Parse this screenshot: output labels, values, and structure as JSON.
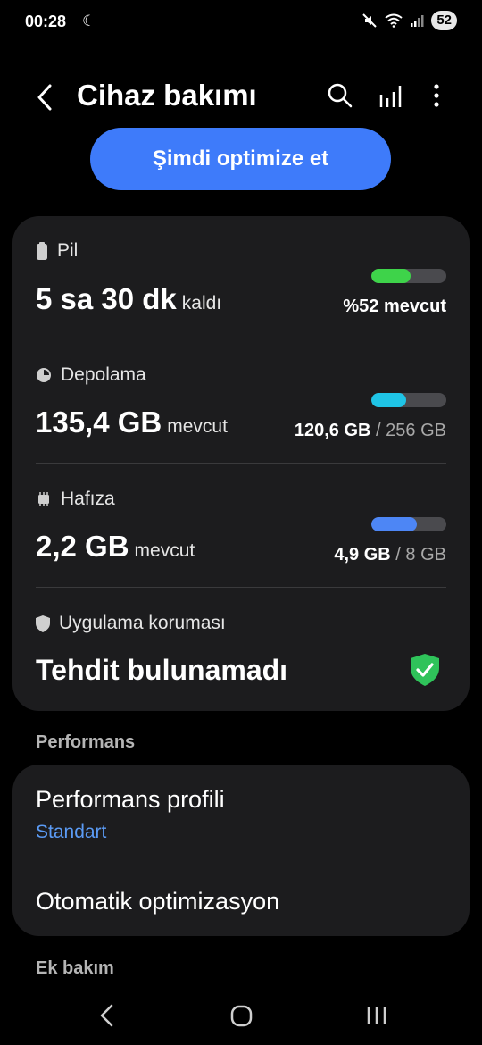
{
  "status": {
    "time": "00:28",
    "battery": "52"
  },
  "header": {
    "title": "Cihaz bakımı"
  },
  "optimize_button": "Şimdi optimize et",
  "battery": {
    "label": "Pil",
    "value": "5 sa 30 dk",
    "suffix": "kaldı",
    "right": "%52 mevcut",
    "fill_percent": 52,
    "color": "#3ed34a"
  },
  "storage": {
    "label": "Depolama",
    "value": "135,4 GB",
    "suffix": "mevcut",
    "used": "120,6 GB",
    "sep": "/",
    "total": "256 GB",
    "fill_percent": 47,
    "color": "#1fc4e6"
  },
  "memory": {
    "label": "Hafıza",
    "value": "2,2 GB",
    "suffix": "mevcut",
    "used": "4,9 GB",
    "sep": "/",
    "total": "8 GB",
    "fill_percent": 61,
    "color": "#4d86f5"
  },
  "protection": {
    "label": "Uygulama koruması",
    "value": "Tehdit bulunamadı",
    "shield_color": "#2fc35a"
  },
  "performance_section": {
    "label": "Performans",
    "profile_title": "Performans profili",
    "profile_value": "Standart",
    "auto_opt": "Otomatik optimizasyon"
  },
  "extra_section": {
    "label": "Ek bakım"
  }
}
